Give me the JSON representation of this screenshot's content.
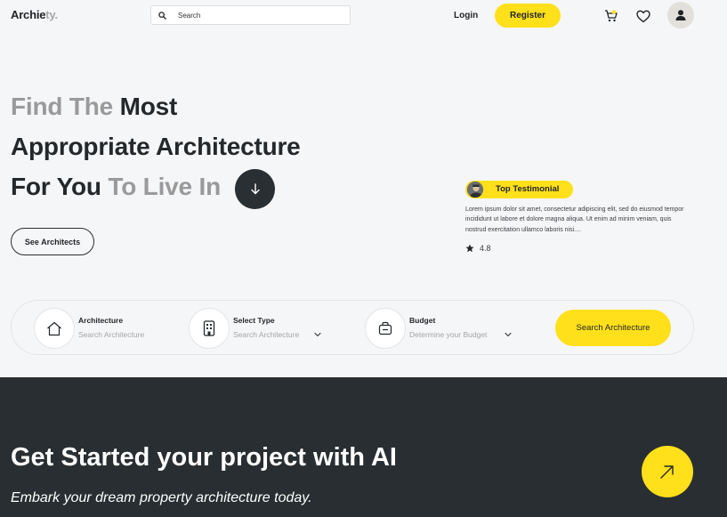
{
  "header": {
    "logo_main": "Archie",
    "logo_dim": "ty.",
    "search_placeholder": "Search",
    "login_label": "Login",
    "register_label": "Register",
    "icons": [
      "search-icon",
      "cart-icon",
      "heart-icon",
      "user-icon"
    ]
  },
  "hero": {
    "line1_dim": "Find The ",
    "line1_main": "Most",
    "line2": "Appropriate Architecture",
    "line3_main": "For You ",
    "line3_dim": "To Live In",
    "see_architects_label": "See Architects"
  },
  "testimonial": {
    "label": "Top Testimonial",
    "text": "Lorem ipsum dolor sit amet, consectetur adipiscing elit, sed do eiusmod tempor incididunt ut labore et dolore magna aliqua. Ut enim ad minim veniam, quis nostrud exercitation ullamco laboris nisi....",
    "rating": "4.8"
  },
  "filters": [
    {
      "label": "Architecture",
      "sub": "Search Architecture"
    },
    {
      "label": "Select Type",
      "sub": "Search Architecture"
    },
    {
      "label": "Budget",
      "sub": "Determine your Budget"
    }
  ],
  "search_button_label": "Search Architecture",
  "cta": {
    "title": "Get Started your project with AI",
    "subtitle": "Embark your dream property architecture today."
  },
  "colors": {
    "accent": "#ffe01b",
    "dark": "#282e31",
    "background": "#f5f6f8"
  }
}
